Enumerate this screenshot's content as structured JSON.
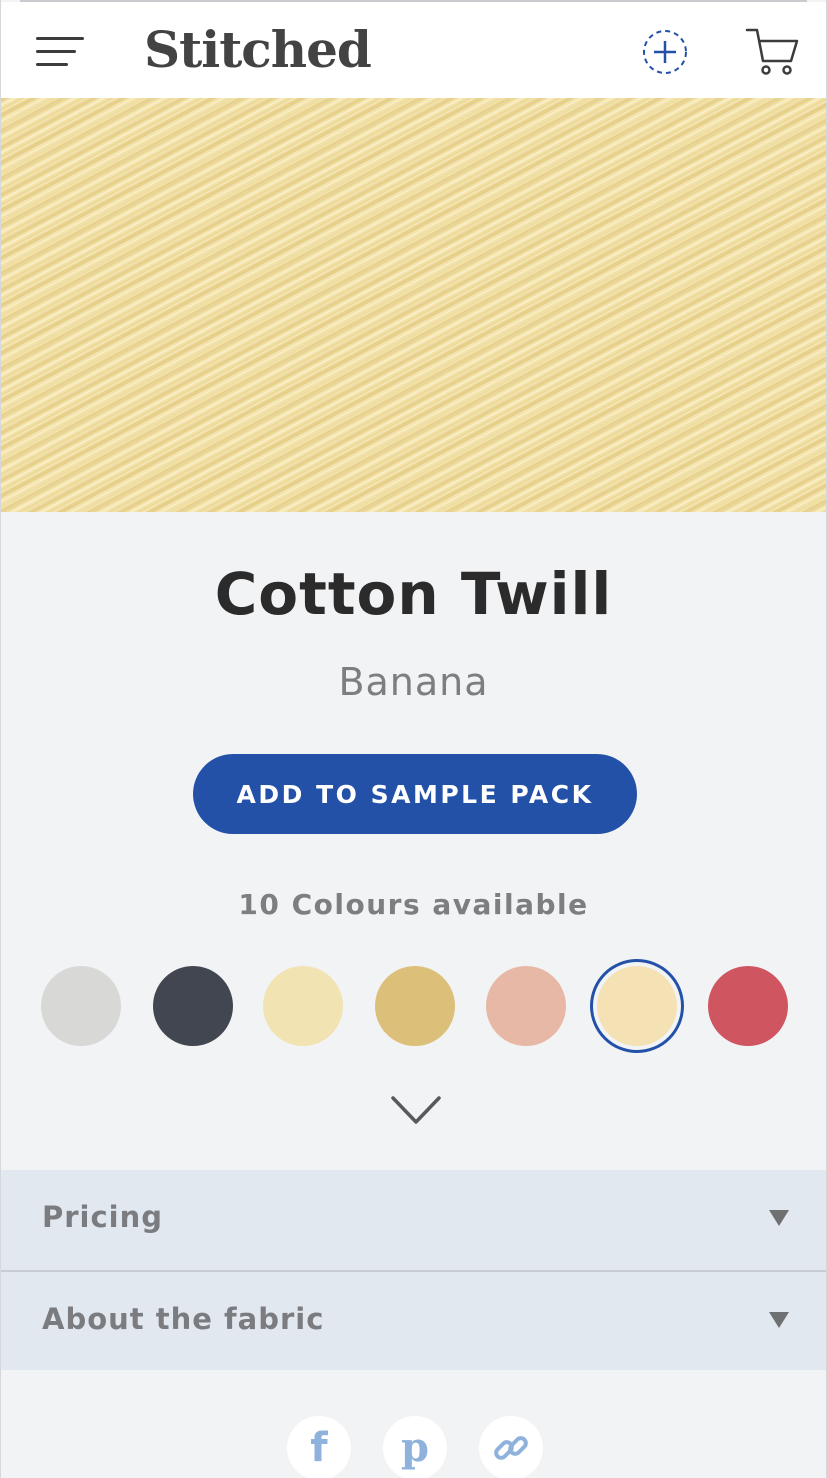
{
  "header": {
    "logo": "Stitched",
    "icons": [
      "menu-icon",
      "sample-pack-add-icon",
      "cart-icon"
    ]
  },
  "hero": {
    "image": "cotton-twill-banana-fabric-texture",
    "color": "#f2e1a6"
  },
  "product": {
    "title": "Cotton Twill",
    "colour_name": "Banana",
    "cta_label": "ADD TO SAMPLE PACK",
    "colours_label": "10 Colours available",
    "swatches": [
      {
        "color": "#d8d8d6",
        "selected": false
      },
      {
        "color": "#414650",
        "selected": false
      },
      {
        "color": "#f2e3b3",
        "selected": false
      },
      {
        "color": "#dcc079",
        "selected": false
      },
      {
        "color": "#e7b8a5",
        "selected": false
      },
      {
        "color": "#f4e2b4",
        "selected": true
      },
      {
        "color": "#cf5560",
        "selected": false
      }
    ]
  },
  "accordion": [
    {
      "label": "Pricing"
    },
    {
      "label": "About the fabric"
    }
  ],
  "social": [
    {
      "icon": "facebook-icon",
      "glyph": "f"
    },
    {
      "icon": "pinterest-icon",
      "glyph": "p"
    },
    {
      "icon": "link-icon",
      "glyph": ""
    }
  ],
  "colors": {
    "accent": "#2451a8",
    "background": "#f2f3f5",
    "accordion_bg": "#e2e8f0",
    "social_icon": "#8fb2dc"
  }
}
